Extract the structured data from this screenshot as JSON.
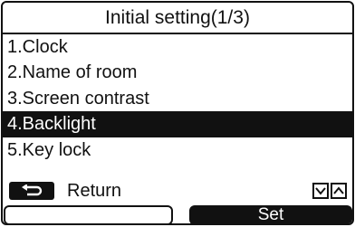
{
  "screen": {
    "title": "Initial setting(1/3)"
  },
  "menu": {
    "items": [
      {
        "label": "1.Clock"
      },
      {
        "label": "2.Name of room"
      },
      {
        "label": "3.Screen contrast"
      },
      {
        "label": "4.Backlight"
      },
      {
        "label": "5.Key lock"
      }
    ],
    "selected_index": 3
  },
  "footer": {
    "return_label": "Return",
    "return_icon": "return-arrow-icon",
    "down_icon": "chevron-down-icon",
    "up_icon": "chevron-up-icon"
  },
  "softkeys": {
    "left_label": "",
    "right_label": "Set"
  },
  "colors": {
    "foreground": "#111111",
    "background": "#ffffff",
    "highlight": "#111111"
  }
}
